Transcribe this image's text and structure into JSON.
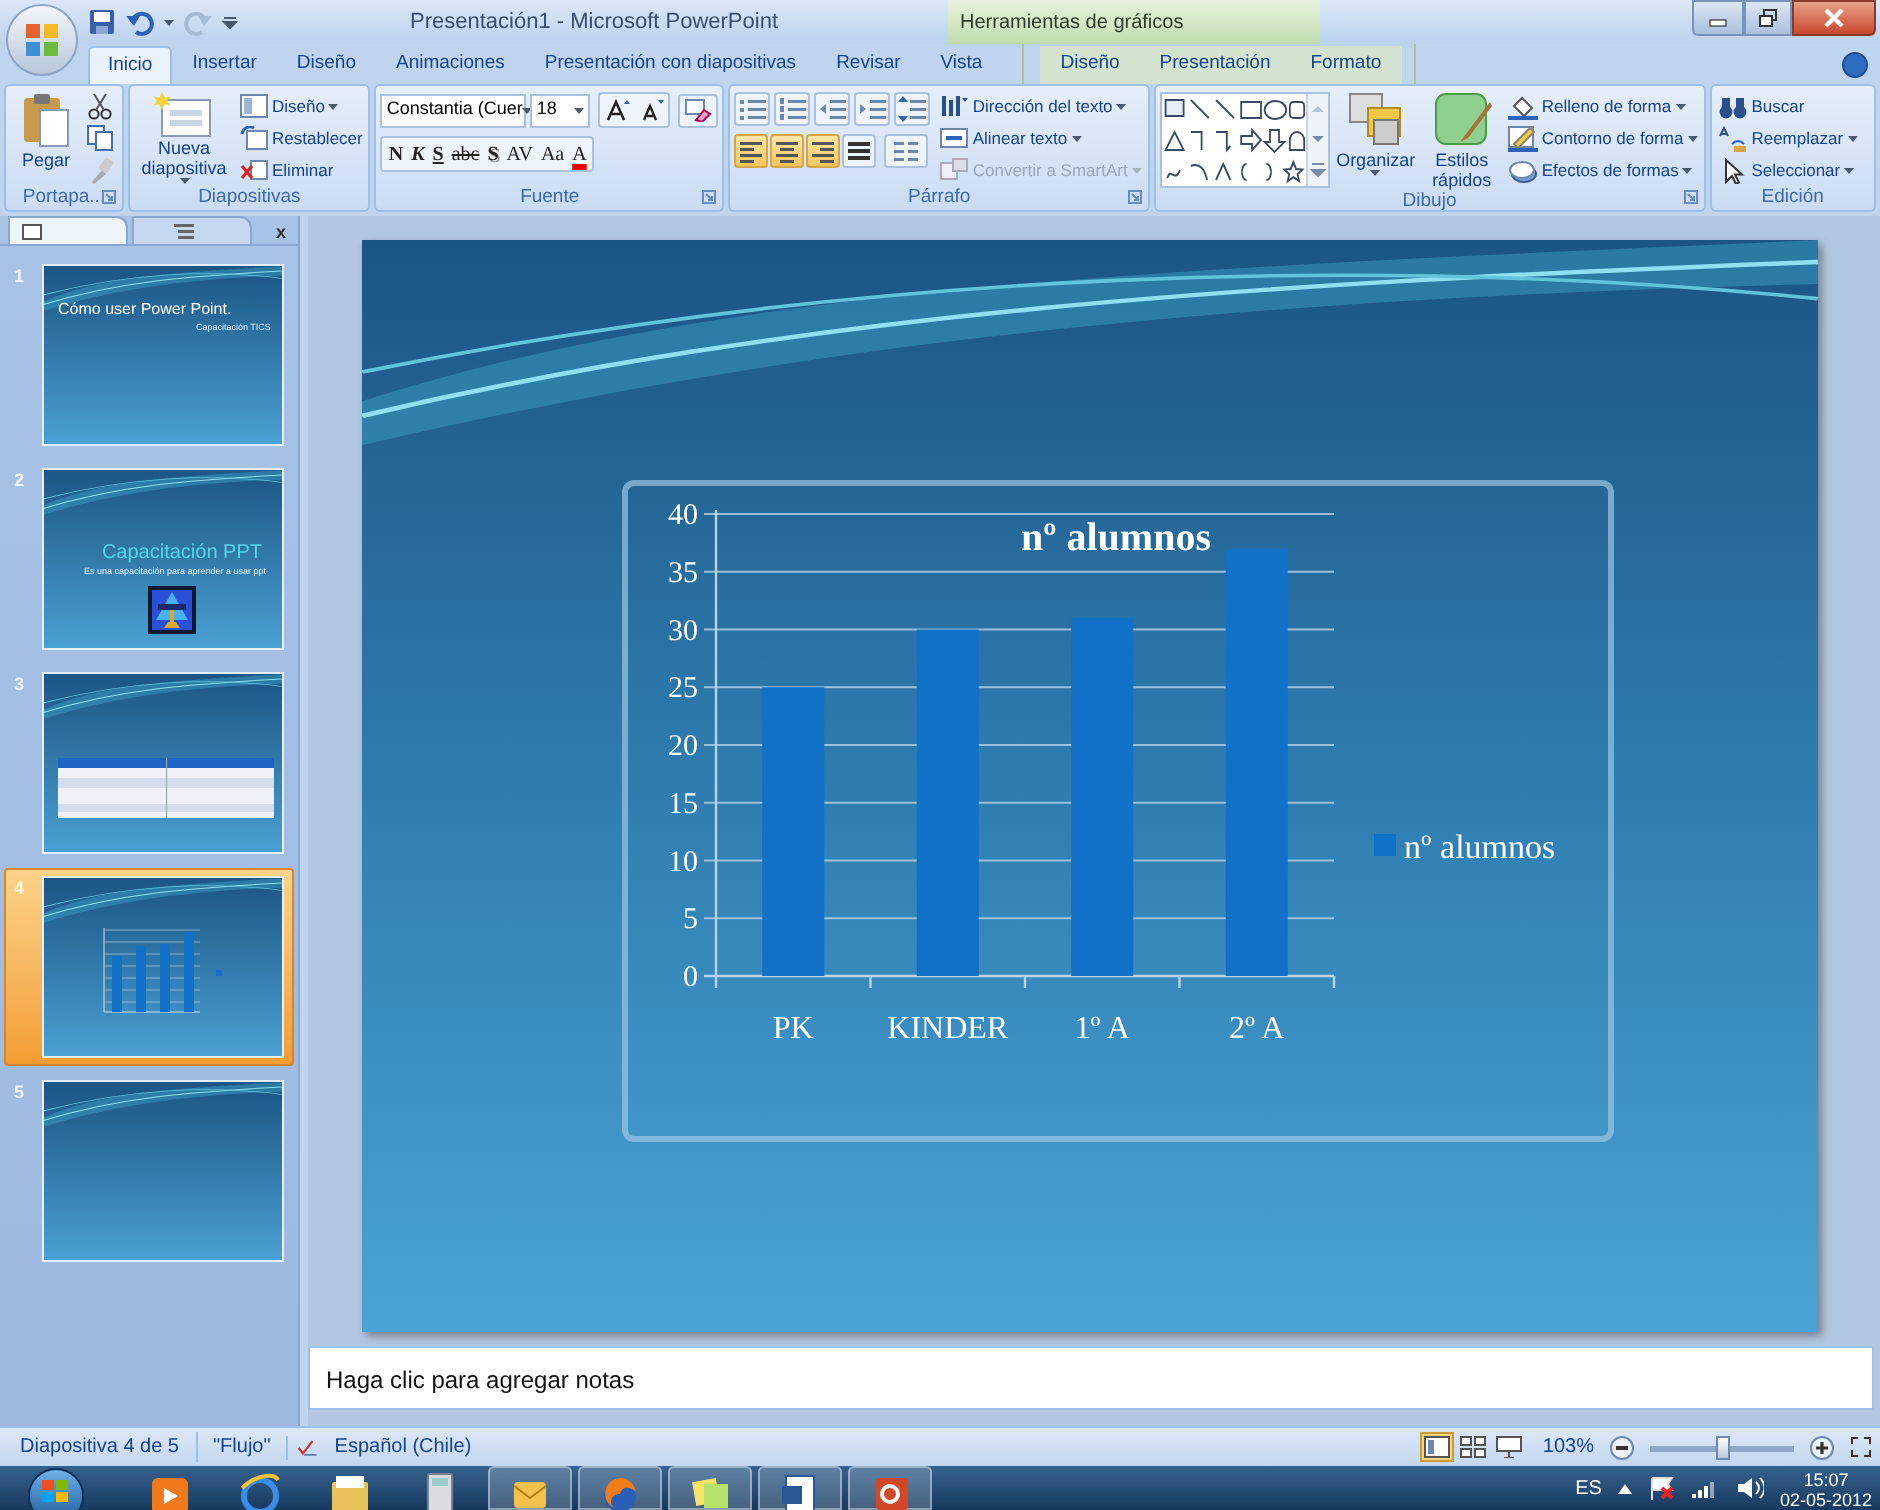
{
  "window": {
    "title": "Presentación1 - Microsoft PowerPoint",
    "contextual_title": "Herramientas de gráficos"
  },
  "tabs": [
    {
      "label": "Inicio",
      "selected": true,
      "contextual": false
    },
    {
      "label": "Insertar",
      "selected": false,
      "contextual": false
    },
    {
      "label": "Diseño",
      "selected": false,
      "contextual": false
    },
    {
      "label": "Animaciones",
      "selected": false,
      "contextual": false
    },
    {
      "label": "Presentación con diapositivas",
      "selected": false,
      "contextual": false
    },
    {
      "label": "Revisar",
      "selected": false,
      "contextual": false
    },
    {
      "label": "Vista",
      "selected": false,
      "contextual": false
    },
    {
      "label": "Diseño",
      "selected": false,
      "contextual": true
    },
    {
      "label": "Presentación",
      "selected": false,
      "contextual": true
    },
    {
      "label": "Formato",
      "selected": false,
      "contextual": true
    }
  ],
  "ribbon": {
    "groups": [
      {
        "kind": "clipboard",
        "label": "Portapa...",
        "paste": "Pegar"
      },
      {
        "kind": "slides",
        "label": "Diapositivas",
        "new_slide": "Nueva diapositiva",
        "commands": [
          "Diseño",
          "Restablecer",
          "Eliminar"
        ]
      },
      {
        "kind": "font",
        "label": "Fuente",
        "font_name": "Constantia (Cuer",
        "font_size": "18",
        "format_buttons": [
          "N",
          "K",
          "S",
          "abc",
          "S",
          "AV",
          "Aa",
          "A"
        ]
      },
      {
        "kind": "paragraph",
        "label": "Párrafo",
        "alignments": [
          {
            "selected": true
          },
          {
            "selected": true
          },
          {
            "selected": true
          },
          {
            "selected": false
          }
        ],
        "commands": [
          {
            "label": "Dirección del texto",
            "disabled": false
          },
          {
            "label": "Alinear texto",
            "disabled": false
          },
          {
            "label": "Convertir a SmartArt",
            "disabled": true
          }
        ]
      },
      {
        "kind": "drawing",
        "label": "Dibujo",
        "arrange": "Organizar",
        "quick_styles": "Estilos rápidos",
        "commands": [
          "Relleno de forma",
          "Contorno de forma",
          "Efectos de formas"
        ]
      },
      {
        "kind": "editing",
        "label": "Edición",
        "commands": [
          "Buscar",
          "Reemplazar",
          "Seleccionar"
        ]
      }
    ]
  },
  "slide_panel": {
    "close": "x",
    "thumbnails": [
      {
        "number": "1",
        "selected": false,
        "kind": "title",
        "title": "Cómo user Power Point.",
        "subtitle": "Capacitación TICS"
      },
      {
        "number": "2",
        "selected": false,
        "kind": "title_picture",
        "title": "Capacitación PPT",
        "subtitle": "Es una capacitación para aprender a usar ppt"
      },
      {
        "number": "3",
        "selected": false,
        "kind": "table"
      },
      {
        "number": "4",
        "selected": true,
        "kind": "chart"
      },
      {
        "number": "5",
        "selected": false,
        "kind": "blank"
      }
    ]
  },
  "slide": {
    "chart_data": {
      "type": "bar",
      "title": "nº alumnos",
      "categories": [
        "PK",
        "KINDER",
        "1º A",
        "2º A"
      ],
      "series": [
        {
          "name": "nº alumnos",
          "color": "#1170c8",
          "values": [
            25,
            30,
            31,
            37
          ]
        }
      ],
      "ylim": [
        0,
        40
      ],
      "grid": true,
      "yticks": [
        0,
        5,
        10,
        15,
        20,
        25,
        30,
        35,
        40
      ]
    }
  },
  "notes": {
    "placeholder": "Haga clic para agregar notas"
  },
  "status_bar": {
    "slide_info": "Diapositiva 4 de 5",
    "theme": "\"Flujo\"",
    "language": "Español (Chile)",
    "zoom": "103%",
    "zoom_slider": {
      "level": 0.51
    }
  },
  "taskbar": {
    "language": "ES",
    "time": "15:07",
    "date": "02-05-2012"
  }
}
